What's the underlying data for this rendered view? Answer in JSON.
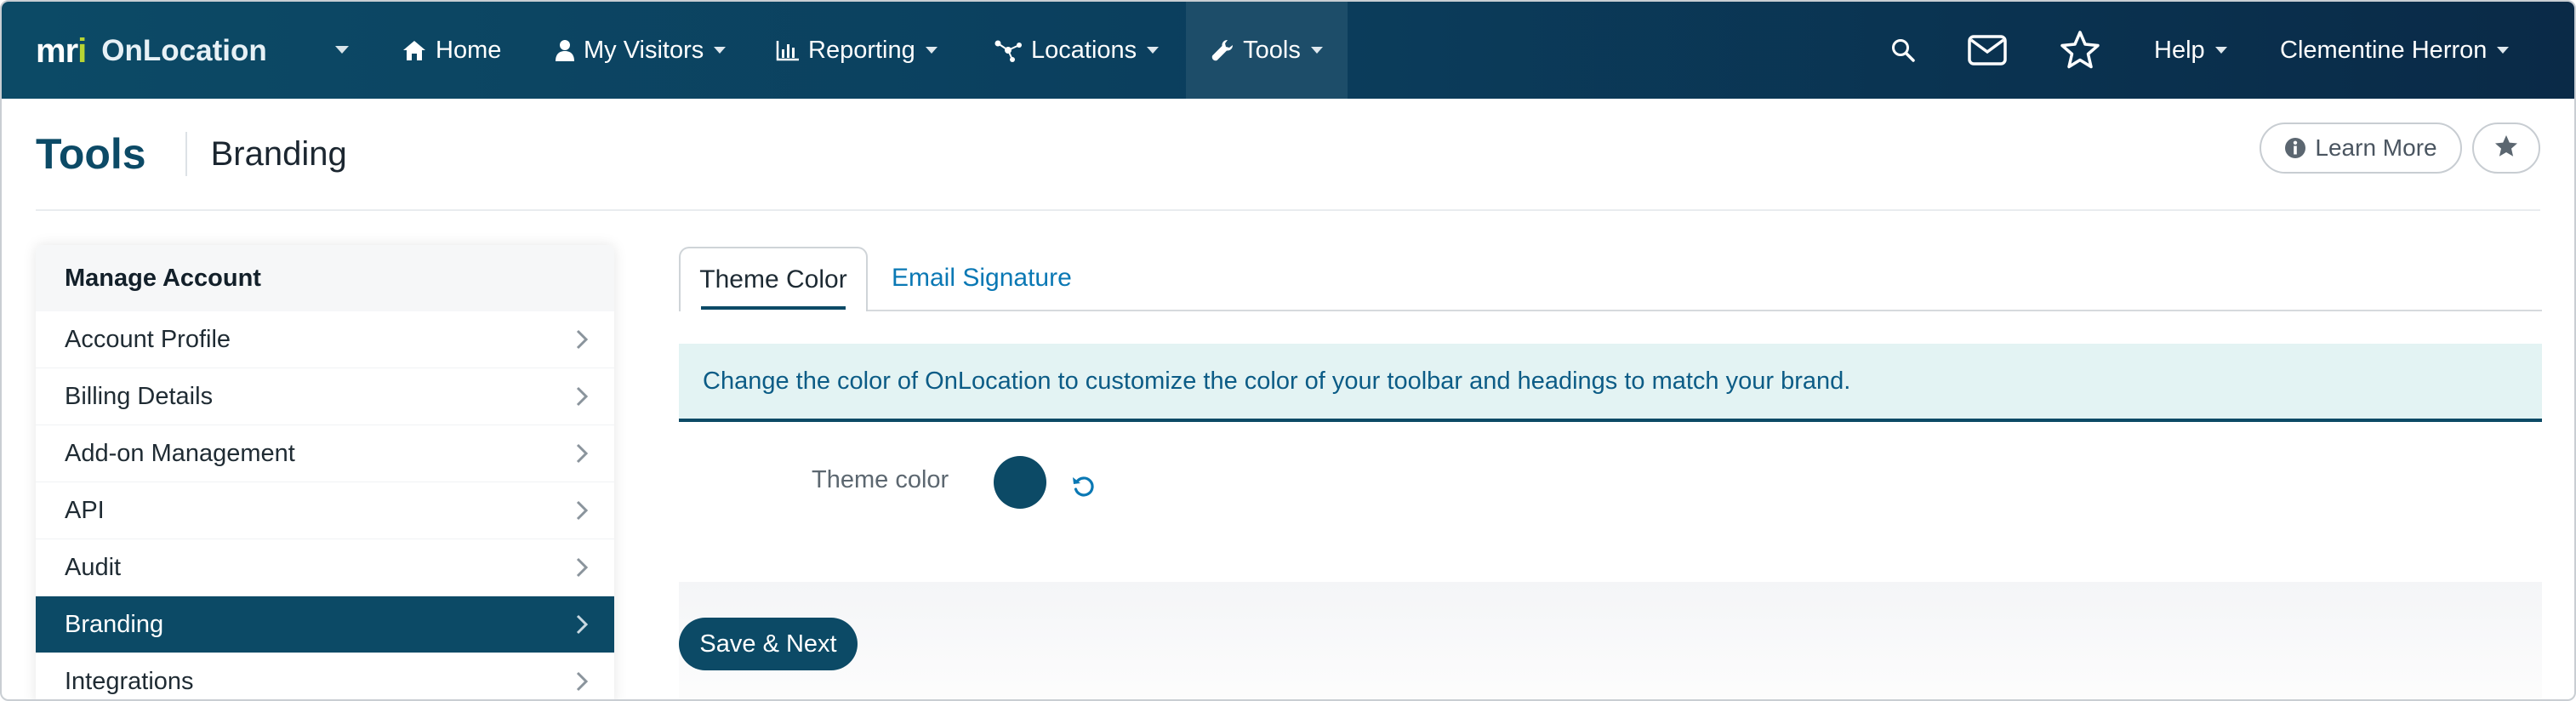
{
  "app": {
    "logo_text_m": "m",
    "logo_text_r": "r",
    "logo_text_i": "i",
    "name": "OnLocation"
  },
  "nav": {
    "items": [
      {
        "label": "Home",
        "icon": "home-icon"
      },
      {
        "label": "My Visitors",
        "icon": "user-icon"
      },
      {
        "label": "Reporting",
        "icon": "bar-chart-icon"
      },
      {
        "label": "Locations",
        "icon": "network-icon"
      },
      {
        "label": "Tools",
        "icon": "wrench-icon"
      }
    ],
    "help_label": "Help",
    "user_name": "Clementine Herron"
  },
  "header": {
    "title": "Tools",
    "subtitle": "Branding",
    "learn_more_label": "Learn More"
  },
  "sidebar": {
    "heading": "Manage Account",
    "items": [
      {
        "label": "Account Profile"
      },
      {
        "label": "Billing Details"
      },
      {
        "label": "Add-on Management"
      },
      {
        "label": "API"
      },
      {
        "label": "Audit"
      },
      {
        "label": "Branding"
      },
      {
        "label": "Integrations"
      }
    ]
  },
  "tabs": [
    {
      "label": "Theme Color"
    },
    {
      "label": "Email Signature"
    }
  ],
  "alert": {
    "text": "Change the color of OnLocation to customize the color of your toolbar and headings to match your brand."
  },
  "theme": {
    "label": "Theme color",
    "value": "#0c4a66"
  },
  "footer": {
    "save_label": "Save & Next"
  },
  "colors": {
    "brand": "#0c4a66",
    "link": "#0a78b4",
    "logo_accent": "#b8d433"
  }
}
